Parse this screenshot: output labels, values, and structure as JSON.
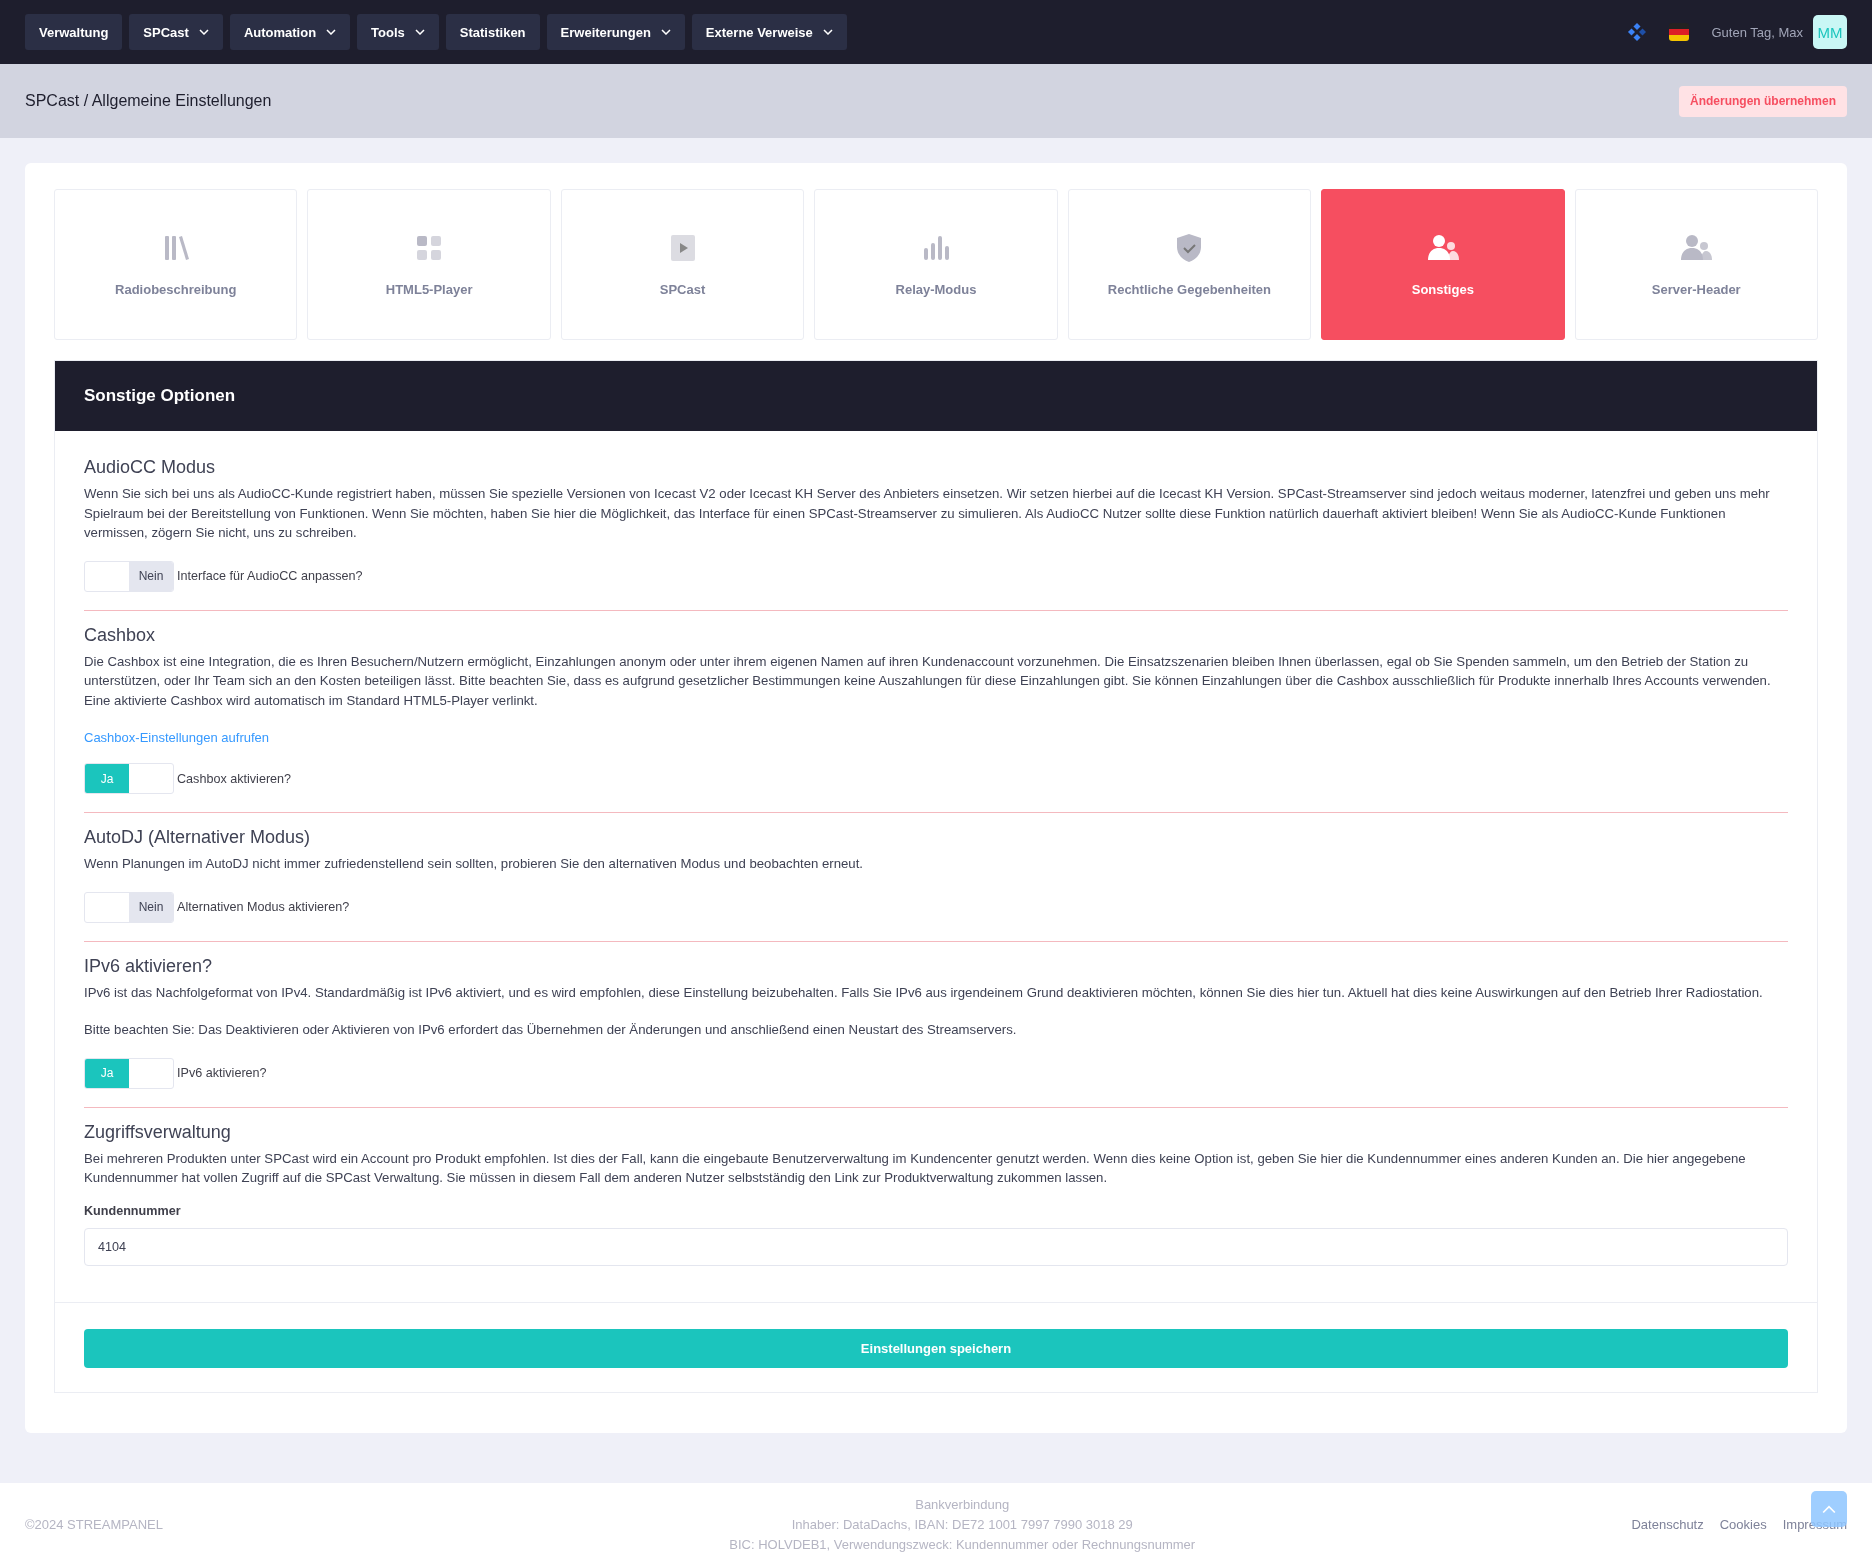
{
  "nav": {
    "items": [
      {
        "label": "Verwaltung",
        "dropdown": false
      },
      {
        "label": "SPCast",
        "dropdown": true
      },
      {
        "label": "Automation",
        "dropdown": true
      },
      {
        "label": "Tools",
        "dropdown": true
      },
      {
        "label": "Statistiken",
        "dropdown": false
      },
      {
        "label": "Erweiterungen",
        "dropdown": true
      },
      {
        "label": "Externe Verweise",
        "dropdown": true
      }
    ],
    "greeting": "Guten Tag, Max",
    "avatar": "MM"
  },
  "header": {
    "breadcrumb": "SPCast / Allgemeine Einstellungen",
    "apply_button": "Änderungen übernehmen"
  },
  "tabs": [
    {
      "label": "Radiobeschreibung",
      "selected": false
    },
    {
      "label": "HTML5-Player",
      "selected": false
    },
    {
      "label": "SPCast",
      "selected": false
    },
    {
      "label": "Relay-Modus",
      "selected": false
    },
    {
      "label": "Rechtliche Gegebenheiten",
      "selected": false
    },
    {
      "label": "Sonstiges",
      "selected": true
    },
    {
      "label": "Server-Header",
      "selected": false
    }
  ],
  "panel_title": "Sonstige Optionen",
  "sections": [
    {
      "title": "AudioCC Modus",
      "paragraphs": [
        "Wenn Sie sich bei uns als AudioCC-Kunde registriert haben, müssen Sie spezielle Versionen von Icecast V2 oder Icecast KH Server des Anbieters einsetzen. Wir setzen hierbei auf die Icecast KH Version. SPCast-Streamserver sind jedoch weitaus moderner, latenzfrei und geben uns mehr Spielraum bei der Bereitstellung von Funktionen. Wenn Sie möchten, haben Sie hier die Möglichkeit, das Interface für einen SPCast-Streamserver zu simulieren. Als AudioCC Nutzer sollte diese Funktion natürlich dauerhaft aktiviert bleiben! Wenn Sie als AudioCC-Kunde Funktionen vermissen, zögern Sie nicht, uns zu schreiben."
      ],
      "toggle": {
        "on": false,
        "state_label": "Nein",
        "label": "Interface für AudioCC anpassen?"
      }
    },
    {
      "title": "Cashbox",
      "paragraphs": [
        "Die Cashbox ist eine Integration, die es Ihren Besuchern/Nutzern ermöglicht, Einzahlungen anonym oder unter ihrem eigenen Namen auf ihren Kundenaccount vorzunehmen. Die Einsatzszenarien bleiben Ihnen überlassen, egal ob Sie Spenden sammeln, um den Betrieb der Station zu unterstützen, oder Ihr Team sich an den Kosten beteiligen lässt. Bitte beachten Sie, dass es aufgrund gesetzlicher Bestimmungen keine Auszahlungen für diese Einzahlungen gibt. Sie können Einzahlungen über die Cashbox ausschließlich für Produkte innerhalb Ihres Accounts verwenden. Eine aktivierte Cashbox wird automatisch im Standard HTML5-Player verlinkt."
      ],
      "link": "Cashbox-Einstellungen aufrufen",
      "toggle": {
        "on": true,
        "state_label": "Ja",
        "label": "Cashbox aktivieren?"
      }
    },
    {
      "title": "AutoDJ (Alternativer Modus)",
      "paragraphs": [
        "Wenn Planungen im AutoDJ nicht immer zufriedenstellend sein sollten, probieren Sie den alternativen Modus und beobachten erneut."
      ],
      "toggle": {
        "on": false,
        "state_label": "Nein",
        "label": "Alternativen Modus aktivieren?"
      }
    },
    {
      "title": "IPv6 aktivieren?",
      "paragraphs": [
        "IPv6 ist das Nachfolgeformat von IPv4. Standardmäßig ist IPv6 aktiviert, und es wird empfohlen, diese Einstellung beizubehalten. Falls Sie IPv6 aus irgendeinem Grund deaktivieren möchten, können Sie dies hier tun. Aktuell hat dies keine Auswirkungen auf den Betrieb Ihrer Radiostation.",
        "Bitte beachten Sie: Das Deaktivieren oder Aktivieren von IPv6 erfordert das Übernehmen der Änderungen und anschließend einen Neustart des Streamservers."
      ],
      "toggle": {
        "on": true,
        "state_label": "Ja",
        "label": "IPv6 aktivieren?"
      }
    },
    {
      "title": "Zugriffsverwaltung",
      "paragraphs": [
        "Bei mehreren Produkten unter SPCast wird ein Account pro Produkt empfohlen. Ist dies der Fall, kann die eingebaute Benutzerverwaltung im Kundencenter genutzt werden. Wenn dies keine Option ist, geben Sie hier die Kundennummer eines anderen Kunden an. Die hier angegebene Kundennummer hat vollen Zugriff auf die SPCast Verwaltung. Sie müssen in diesem Fall dem anderen Nutzer selbstständig den Link zur Produktverwaltung zukommen lassen."
      ],
      "field": {
        "label": "Kundennummer",
        "value": "4104"
      }
    }
  ],
  "save_button": "Einstellungen speichern",
  "footer": {
    "copyright": "©2024 STREAMPANEL",
    "bank_lines": [
      "Bankverbindung",
      "Inhaber: DataDachs, IBAN: DE72 1001 7997 7990 3018 29",
      "BIC: HOLVDEB1, Verwendungszweck: Kundennummer oder Rechnungsnummer"
    ],
    "links": [
      "Datenschutz",
      "Cookies",
      "Impressum"
    ]
  }
}
